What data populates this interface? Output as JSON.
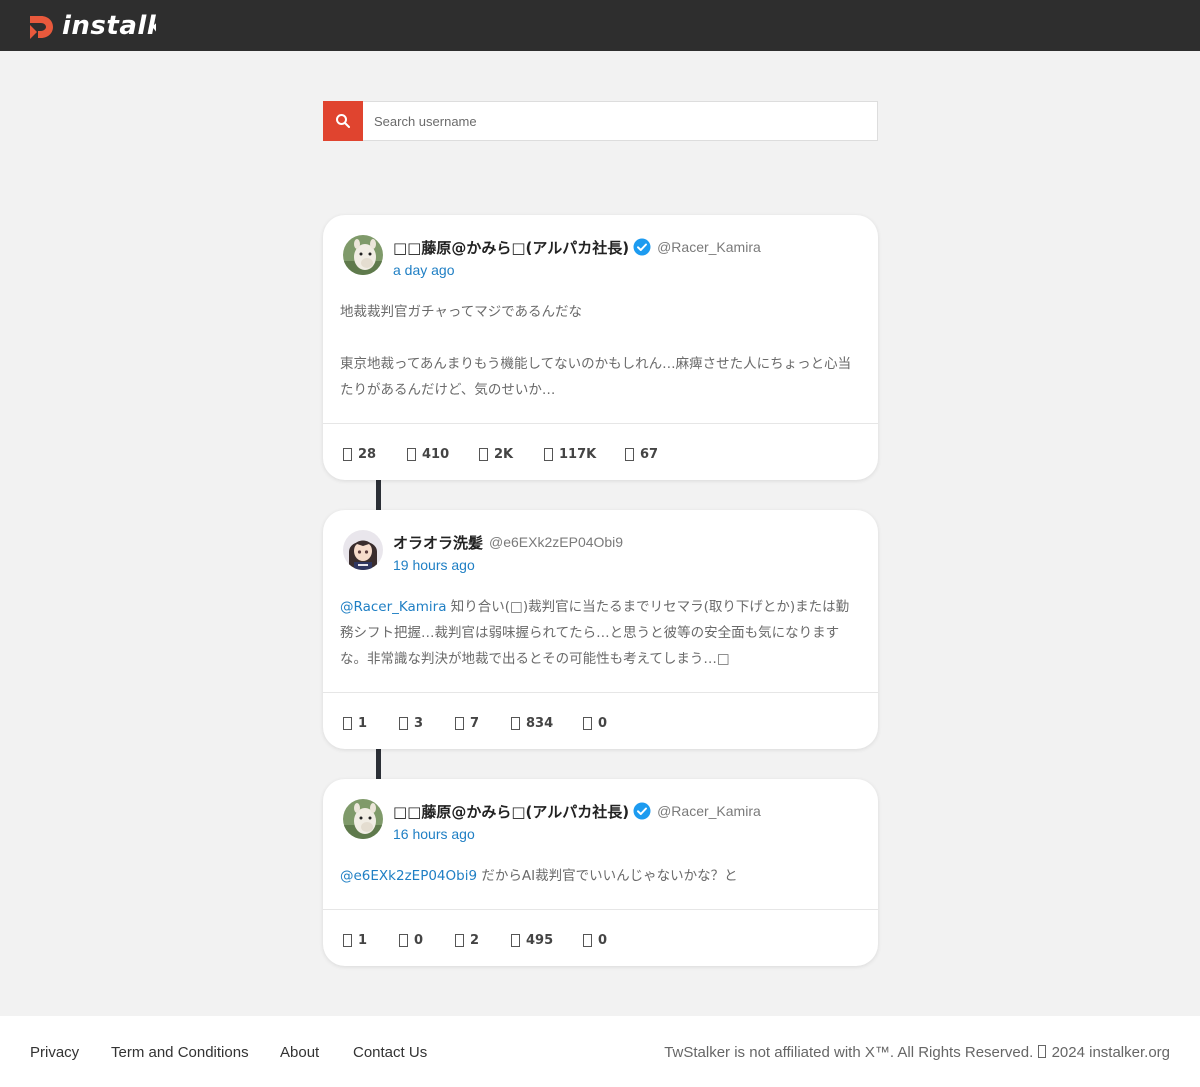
{
  "header": {
    "logo_text": "instalk",
    "brand_color": "#e8593c"
  },
  "search": {
    "placeholder": "Search username",
    "button_icon": "search-icon",
    "button_color": "#e0442f"
  },
  "tweets": [
    {
      "display_name": "□□藤原@かみら□(アルパカ社長)",
      "verified": true,
      "handle": "@Racer_Kamira",
      "time": "a day ago",
      "body": [
        "地裁裁判官ガチャってマジであるんだな",
        "東京地裁ってあんまりもう機能してないのかもしれん…麻痺させた人にちょっと心当たりがあるんだけど、気のせいか…"
      ],
      "stats": [
        "28",
        "410",
        "2K",
        "117K",
        "67"
      ]
    },
    {
      "display_name": "オラオラ洗髪",
      "verified": false,
      "handle": "@e6EXk2zEP04Obi9",
      "time": "19 hours ago",
      "mention": "@Racer_Kamira",
      "body_text": " 知り合い(□)裁判官に当たるまでリセマラ(取り下げとか)または勤務シフト把握…裁判官は弱味握られてたら…と思うと彼等の安全面も気になりますな。非常識な判決が地裁で出るとその可能性も考えてしまう…□",
      "stats": [
        "1",
        "3",
        "7",
        "834",
        "0"
      ]
    },
    {
      "display_name": "□□藤原@かみら□(アルパカ社長)",
      "verified": true,
      "handle": "@Racer_Kamira",
      "time": "16 hours ago",
      "mention": "@e6EXk2zEP04Obi9",
      "body_text": " だからAI裁判官でいいんじゃないかな？と",
      "stats": [
        "1",
        "0",
        "2",
        "495",
        "0"
      ]
    }
  ],
  "footer": {
    "links": [
      "Privacy",
      "Term and Conditions",
      "About",
      "Contact Us"
    ],
    "copyright_pre": "TwStalker is not affiliated with X™. All Rights Reserved. ",
    "copyright_post": " 2024 instalker.org"
  },
  "colors": {
    "link_blue": "#1f7fc4",
    "verified_blue": "#1d9bf0",
    "topbar": "#2e2e2e"
  }
}
